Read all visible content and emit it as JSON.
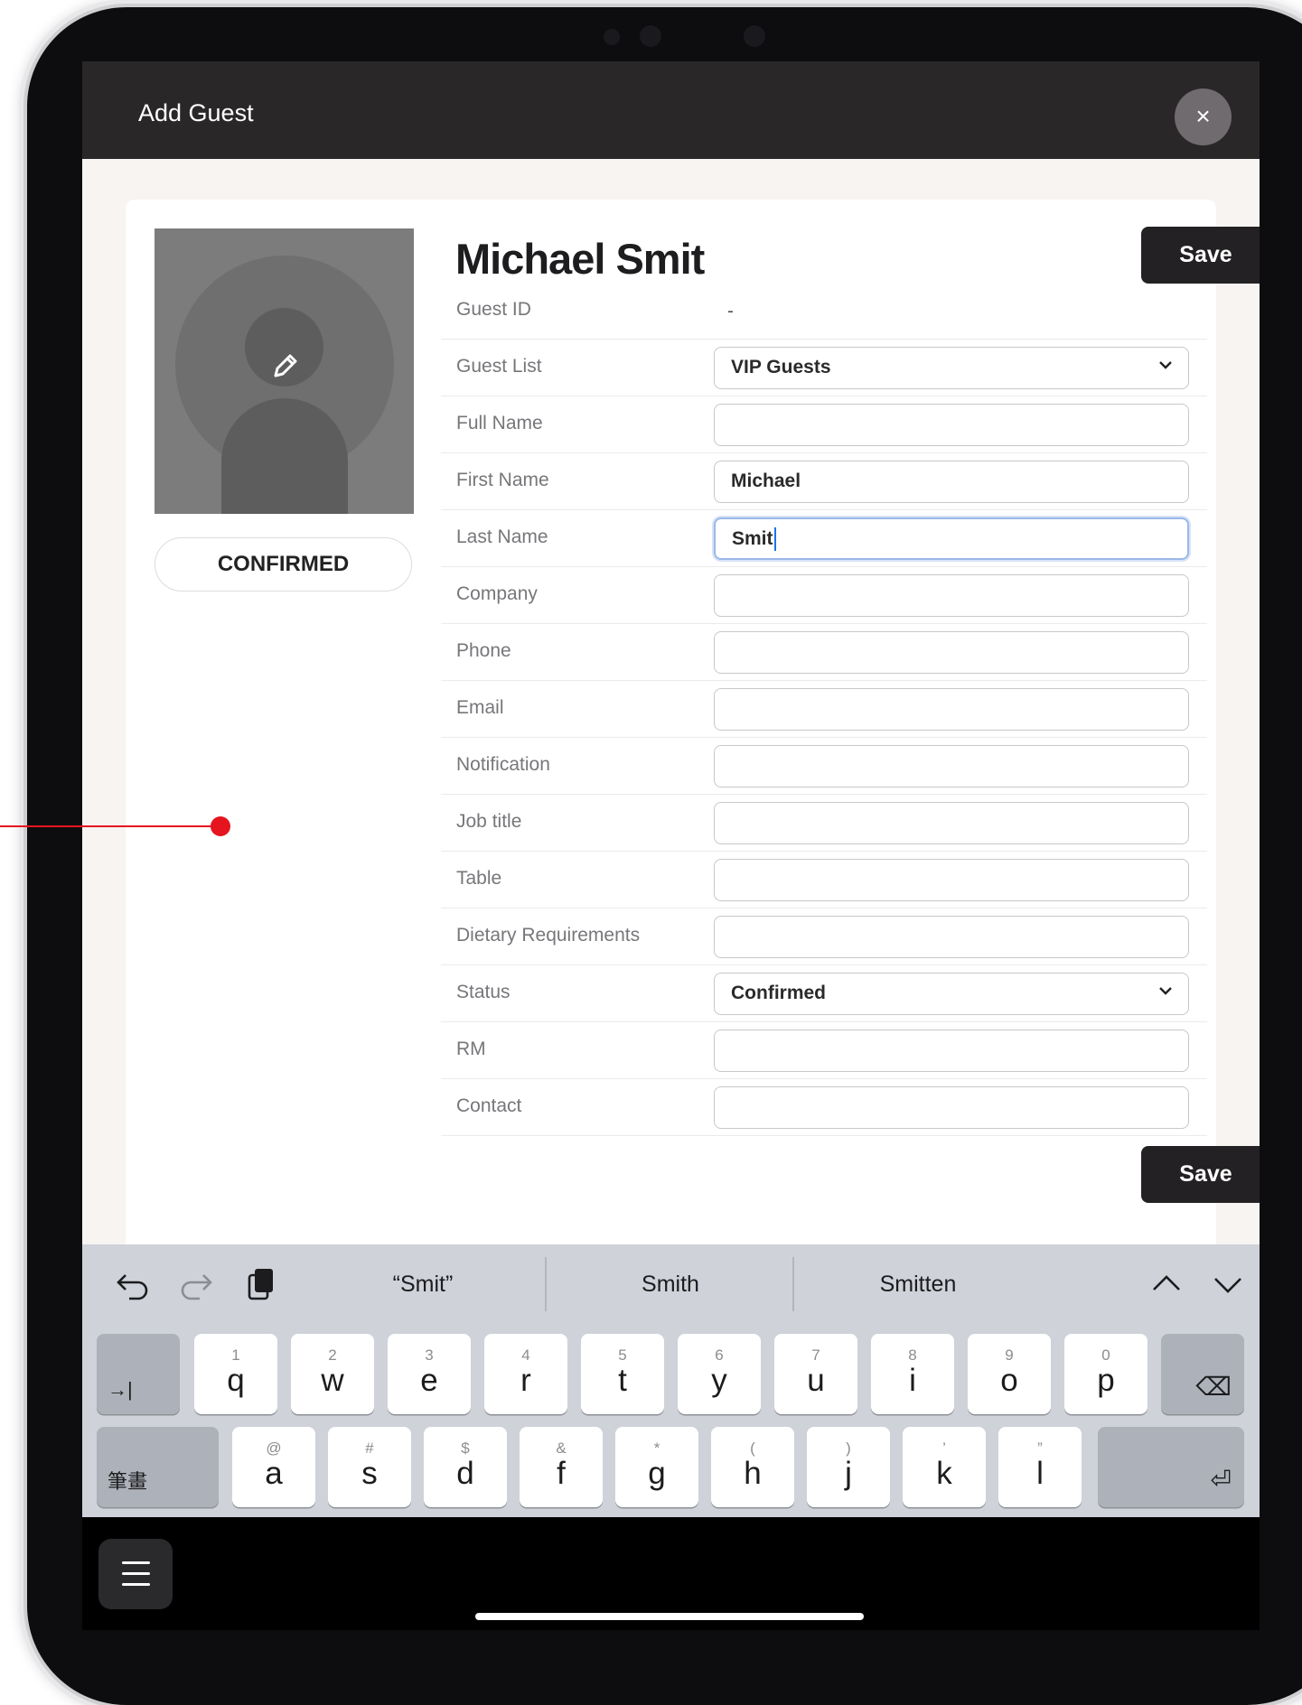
{
  "header": {
    "title": "Add Guest",
    "close_icon": "×"
  },
  "profile": {
    "status_badge": "CONFIRMED"
  },
  "guest": {
    "name": "Michael Smit"
  },
  "buttons": {
    "save_top": "Save",
    "save_bottom": "Save"
  },
  "form": {
    "rows": [
      {
        "label": "Guest ID",
        "value": "-"
      },
      {
        "label": "Guest List",
        "value": "VIP Guests"
      },
      {
        "label": "Full Name",
        "value": ""
      },
      {
        "label": "First Name",
        "value": "Michael"
      },
      {
        "label": "Last Name",
        "value": "Smit"
      },
      {
        "label": "Company",
        "value": ""
      },
      {
        "label": "Phone",
        "value": ""
      },
      {
        "label": "Email",
        "value": ""
      },
      {
        "label": "Notification",
        "value": ""
      },
      {
        "label": "Job title",
        "value": ""
      },
      {
        "label": "Table",
        "value": ""
      },
      {
        "label": "Dietary Requirements",
        "value": ""
      },
      {
        "label": "Status",
        "value": "Confirmed"
      },
      {
        "label": "RM",
        "value": ""
      },
      {
        "label": "Contact",
        "value": ""
      }
    ]
  },
  "keyboard": {
    "suggestions": [
      "“Smit”",
      "Smith",
      "Smitten"
    ],
    "row1": [
      {
        "num": "1",
        "ch": "q"
      },
      {
        "num": "2",
        "ch": "w"
      },
      {
        "num": "3",
        "ch": "e"
      },
      {
        "num": "4",
        "ch": "r"
      },
      {
        "num": "5",
        "ch": "t"
      },
      {
        "num": "6",
        "ch": "y"
      },
      {
        "num": "7",
        "ch": "u"
      },
      {
        "num": "8",
        "ch": "i"
      },
      {
        "num": "9",
        "ch": "o"
      },
      {
        "num": "0",
        "ch": "p"
      }
    ],
    "row2": [
      {
        "num": "@",
        "ch": "a"
      },
      {
        "num": "#",
        "ch": "s"
      },
      {
        "num": "$",
        "ch": "d"
      },
      {
        "num": "&",
        "ch": "f"
      },
      {
        "num": "*",
        "ch": "g"
      },
      {
        "num": "(",
        "ch": "h"
      },
      {
        "num": ")",
        "ch": "j"
      },
      {
        "num": "’",
        "ch": "k"
      },
      {
        "num": "”",
        "ch": "l"
      }
    ],
    "tab_key": "→|",
    "mode_key": "筆畫",
    "delete_key": "⌫",
    "return_key": "⏎"
  },
  "colors": {
    "accent": "#232123",
    "focus": "#9ab8e8",
    "pointer": "#e5141f"
  }
}
